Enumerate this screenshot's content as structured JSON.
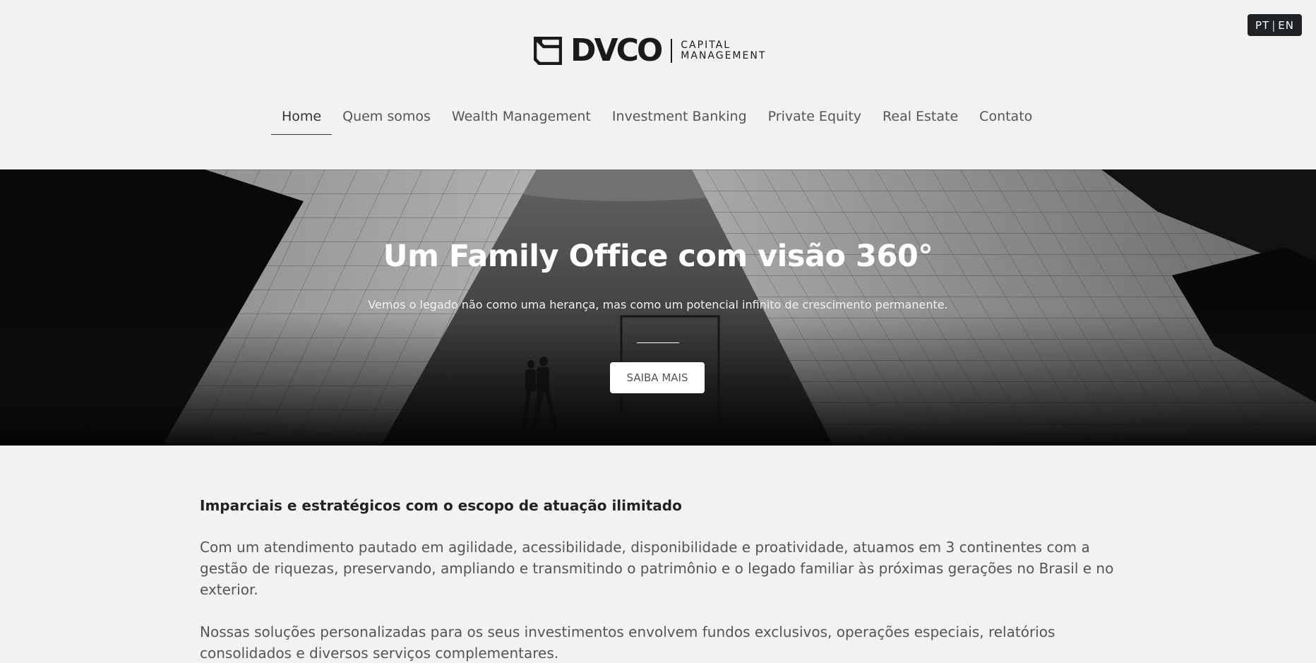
{
  "lang_toggle": {
    "pt": "PT",
    "sep": "|",
    "en": "EN"
  },
  "logo": {
    "wordmark": "DVCO",
    "sub_line1": "CAPITAL",
    "sub_line2": "MANAGEMENT",
    "icon": "dvco-square-logo-icon"
  },
  "nav": {
    "items": [
      {
        "label": "Home",
        "active": true
      },
      {
        "label": "Quem somos"
      },
      {
        "label": "Wealth Management"
      },
      {
        "label": "Investment Banking"
      },
      {
        "label": "Private Equity"
      },
      {
        "label": "Real Estate"
      },
      {
        "label": "Contato"
      }
    ]
  },
  "hero": {
    "title": "Um Family Office com visão 360°",
    "subtitle": "Vemos o legado não como uma herança, mas como um potencial infinito de crescimento permanente.",
    "button": "SAIBA MAIS"
  },
  "content": {
    "heading": "Imparciais e estratégicos com o escopo de atuação ilimitado",
    "paragraphs": [
      "Com um atendimento pautado em agilidade, acessibilidade, disponibilidade e proatividade, atuamos em 3 continentes com a gestão de riquezas, preservando, ampliando e transmitindo o patrimônio e o legado familiar às próximas gerações no Brasil e no exterior.",
      "Nossas soluções personalizadas para os seus investimentos envolvem fundos exclusivos, operações especiais, relatórios consolidados e diversos serviços complementares."
    ]
  }
}
